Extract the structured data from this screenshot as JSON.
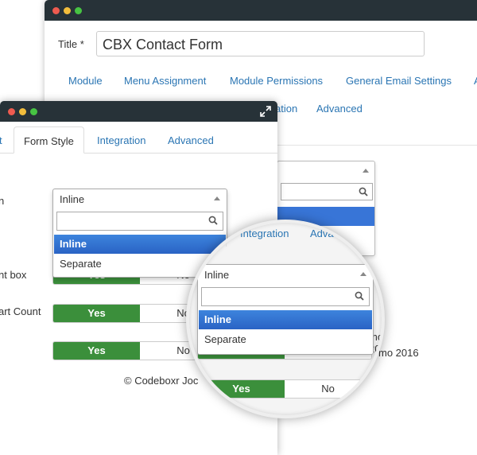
{
  "back_window": {
    "title_label": "Title *",
    "title_value": "CBX Contact Form",
    "tabs": [
      "Module",
      "Menu Assignment",
      "Module Permissions",
      "General Email Settings",
      "A"
    ],
    "tabs_row2": [
      "ation",
      "Advanced"
    ],
    "right_text": "mo 2016"
  },
  "front_window": {
    "tabs": [
      "t",
      "Form Style",
      "Integration",
      "Advanced"
    ],
    "labels": [
      "n",
      "nt box",
      "art Count"
    ],
    "select": {
      "value": "Inline",
      "options": [
        "Inline",
        "Separate"
      ]
    },
    "toggles": [
      {
        "yes": "Yes",
        "no": "No"
      },
      {
        "yes": "Yes",
        "no": "No"
      },
      {
        "yes": "Yes",
        "no": "No"
      }
    ],
    "footer": "© Codeboxr Joc"
  },
  "magnifier": {
    "tabs": [
      "Integration",
      "Adva"
    ],
    "select": {
      "value": "Inline",
      "options": [
        "Inline",
        "Separate"
      ]
    },
    "toggles": [
      {
        "yes": "Yes",
        "no": "No"
      },
      {
        "yes": "Yes",
        "no": "No"
      }
    ],
    "peek_no": "No"
  }
}
